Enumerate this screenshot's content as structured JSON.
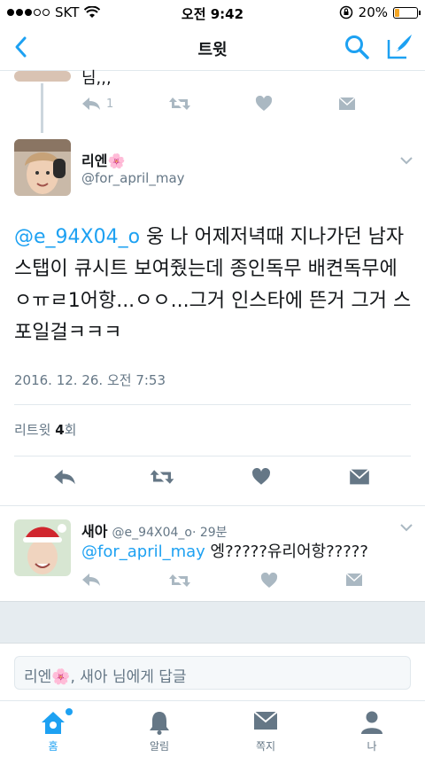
{
  "status_bar": {
    "carrier": "SKT",
    "time": "오전 9:42",
    "battery_percent": "20%",
    "signal_bars_filled": 3,
    "signal_bars_total": 5
  },
  "nav": {
    "title": "트윗",
    "back_icon": "chevron-left-icon",
    "search_icon": "search-icon",
    "compose_icon": "compose-icon"
  },
  "parent_tweet": {
    "text_fragment": "님,,,",
    "reply_count": "1"
  },
  "main_tweet": {
    "display_name": "리엔🌸",
    "handle": "@for_april_may",
    "mention": "@e_94X04_o",
    "body": " 웅 나 어제저녁때 지나가던 남자스탭이 큐시트 보여줬는데 종인독무 배켠독무에 ㅇㅠㄹ1어항...ㅇㅇ...그거 인스타에 뜬거 그거 스포일걸ㅋㅋㅋ",
    "timestamp": "2016. 12. 26. 오전 7:53",
    "retweets_label": "리트윗",
    "retweets_count": "4",
    "retweets_suffix": "회"
  },
  "reply_tweet": {
    "display_name": "새아",
    "handle": "@e_94X04_o",
    "time_ago": "· 29분",
    "mention": "@for_april_may",
    "body": " 엥?????유리어항?????"
  },
  "reply_box": {
    "placeholder": "리엔🌸, 새아 님에게 답글"
  },
  "tabs": [
    {
      "label": "홈",
      "icon": "home-icon",
      "active": true
    },
    {
      "label": "알림",
      "icon": "bell-icon",
      "active": false
    },
    {
      "label": "쪽지",
      "icon": "envelope-icon",
      "active": false
    },
    {
      "label": "나",
      "icon": "person-icon",
      "active": false
    }
  ],
  "colors": {
    "accent": "#1da1f2",
    "muted_icon": "#aab8c2",
    "secondary_text": "#657786",
    "band": "#e6ecf0"
  }
}
